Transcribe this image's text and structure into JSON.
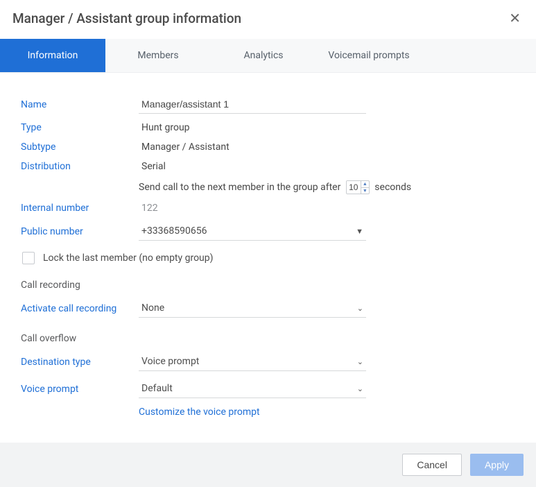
{
  "header": {
    "title": "Manager / Assistant group information"
  },
  "tabs": {
    "information": "Information",
    "members": "Members",
    "analytics": "Analytics",
    "voicemail": "Voicemail prompts"
  },
  "labels": {
    "name": "Name",
    "type": "Type",
    "subtype": "Subtype",
    "distribution": "Distribution",
    "internal_number": "Internal number",
    "public_number": "Public number",
    "lock_last_member": "Lock the last member (no empty group)",
    "call_recording_section": "Call recording",
    "activate_recording": "Activate call recording",
    "call_overflow_section": "Call overflow",
    "destination_type": "Destination type",
    "voice_prompt": "Voice prompt",
    "customize_voice": "Customize the voice prompt"
  },
  "values": {
    "name": "Manager/assistant 1",
    "type": "Hunt group",
    "subtype": "Manager / Assistant",
    "distribution": "Serial",
    "ring_seconds": "10",
    "internal_number": "122",
    "public_number": "+33368590656",
    "lock_last_member_checked": false,
    "activate_recording": "None",
    "destination_type": "Voice prompt",
    "voice_prompt": "Default"
  },
  "distribution_sentence": {
    "prefix": "Send call to the next member in the group after",
    "suffix": "seconds"
  },
  "footer": {
    "cancel": "Cancel",
    "apply": "Apply"
  }
}
